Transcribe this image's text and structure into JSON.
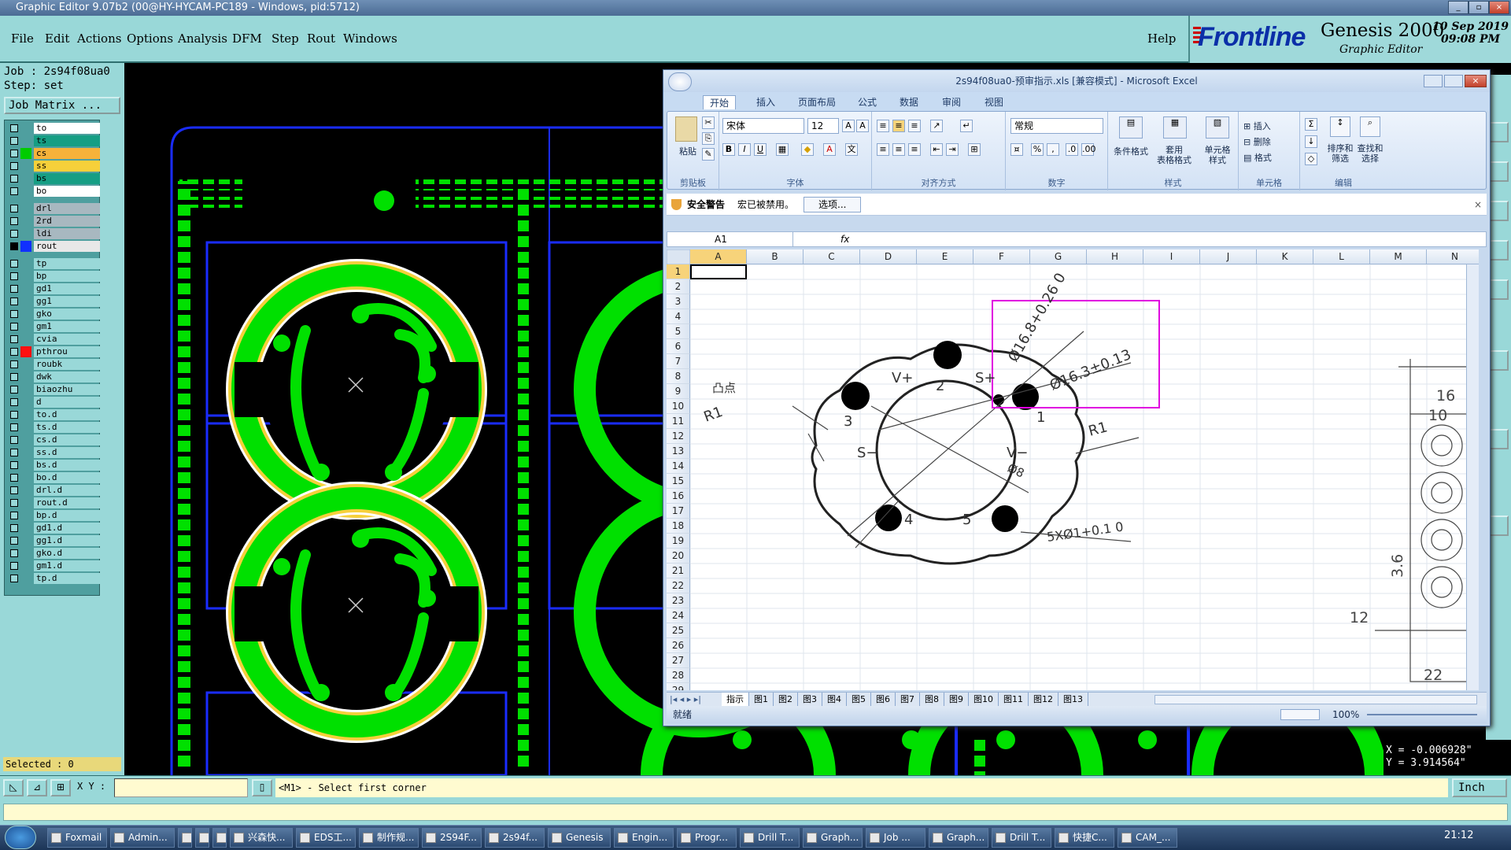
{
  "window": {
    "title": "Graphic Editor 9.07b2 (00@HY-HYCAM-PC189 - Windows, pid:5712)"
  },
  "menu": [
    "File",
    "Edit",
    "Actions",
    "Options",
    "Analysis",
    "DFM",
    "Step",
    "Rout",
    "Windows"
  ],
  "help_label": "Help",
  "branding": {
    "logo": "Frontline",
    "product": "Genesis 2000",
    "subtitle": "Graphic Editor",
    "date": "10 Sep 2019",
    "time": "09:08 PM"
  },
  "job": {
    "job_label": "Job : 2s94f08ua0",
    "step_label": "Step: set",
    "matrix_button": "Job Matrix ..."
  },
  "layers": [
    {
      "name": "to",
      "color": "#ffffff",
      "swatch": "",
      "checked": false
    },
    {
      "name": "ts",
      "color": "#169e84",
      "swatch": "",
      "checked": false
    },
    {
      "name": "cs",
      "color": "#f6b23a",
      "swatch": "#00cc00",
      "checked": false
    },
    {
      "name": "ss",
      "color": "#f6d03a",
      "swatch": "",
      "checked": false
    },
    {
      "name": "bs",
      "color": "#169e84",
      "swatch": "",
      "checked": false
    },
    {
      "name": "bo",
      "color": "#ffffff",
      "swatch": "",
      "checked": false
    },
    {
      "name": "drl",
      "color": "#a8b8c0",
      "swatch": "",
      "checked": false
    },
    {
      "name": "2rd",
      "color": "#a8b8c0",
      "swatch": "",
      "checked": false
    },
    {
      "name": "ldi",
      "color": "#a8b8c0",
      "swatch": "",
      "checked": false
    },
    {
      "name": "rout",
      "color": "#e8e8e8",
      "swatch": "#1030ff",
      "checked": true
    },
    {
      "name": "tp",
      "color": "#99d8d8",
      "swatch": "",
      "checked": false
    },
    {
      "name": "bp",
      "color": "#99d8d8",
      "swatch": "",
      "checked": false
    },
    {
      "name": "gd1",
      "color": "#99d8d8",
      "swatch": "",
      "checked": false
    },
    {
      "name": "gg1",
      "color": "#99d8d8",
      "swatch": "",
      "checked": false
    },
    {
      "name": "gko",
      "color": "#99d8d8",
      "swatch": "",
      "checked": false
    },
    {
      "name": "gm1",
      "color": "#99d8d8",
      "swatch": "",
      "checked": false
    },
    {
      "name": "cvia",
      "color": "#99d8d8",
      "swatch": "",
      "checked": false
    },
    {
      "name": "pthrou",
      "color": "#99d8d8",
      "swatch": "#ff1010",
      "checked": false
    },
    {
      "name": "roubk",
      "color": "#99d8d8",
      "swatch": "",
      "checked": false
    },
    {
      "name": "dwk",
      "color": "#99d8d8",
      "swatch": "",
      "checked": false
    },
    {
      "name": "biaozhu",
      "color": "#99d8d8",
      "swatch": "",
      "checked": false
    },
    {
      "name": "d",
      "color": "#99d8d8",
      "swatch": "",
      "checked": false
    },
    {
      "name": "to.d",
      "color": "#99d8d8",
      "swatch": "",
      "checked": false
    },
    {
      "name": "ts.d",
      "color": "#99d8d8",
      "swatch": "",
      "checked": false
    },
    {
      "name": "cs.d",
      "color": "#99d8d8",
      "swatch": "",
      "checked": false
    },
    {
      "name": "ss.d",
      "color": "#99d8d8",
      "swatch": "",
      "checked": false
    },
    {
      "name": "bs.d",
      "color": "#99d8d8",
      "swatch": "",
      "checked": false
    },
    {
      "name": "bo.d",
      "color": "#99d8d8",
      "swatch": "",
      "checked": false
    },
    {
      "name": "drl.d",
      "color": "#99d8d8",
      "swatch": "",
      "checked": false
    },
    {
      "name": "rout.d",
      "color": "#99d8d8",
      "swatch": "",
      "checked": false
    },
    {
      "name": "bp.d",
      "color": "#99d8d8",
      "swatch": "",
      "checked": false
    },
    {
      "name": "gd1.d",
      "color": "#99d8d8",
      "swatch": "",
      "checked": false
    },
    {
      "name": "gg1.d",
      "color": "#99d8d8",
      "swatch": "",
      "checked": false
    },
    {
      "name": "gko.d",
      "color": "#99d8d8",
      "swatch": "",
      "checked": false
    },
    {
      "name": "gm1.d",
      "color": "#99d8d8",
      "swatch": "",
      "checked": false
    },
    {
      "name": "tp.d",
      "color": "#99d8d8",
      "swatch": "",
      "checked": false
    }
  ],
  "selected_label": "Selected : 0",
  "coords": {
    "x": "X = -0.006928\"",
    "y": "Y = 3.914564\""
  },
  "statusbar": {
    "xy_label": "X Y :",
    "prompt": "<M1> - Select first corner",
    "unit": "Inch"
  },
  "excel": {
    "title": "2s94f08ua0-预审指示.xls  [兼容模式]  -  Microsoft Excel",
    "tabs": [
      "开始",
      "插入",
      "页面布局",
      "公式",
      "数据",
      "审阅",
      "视图"
    ],
    "ribbon": {
      "paste": "粘贴",
      "clipboard": "剪贴板",
      "font_name": "宋体",
      "font_size": "12",
      "font_group": "字体",
      "align_group": "对齐方式",
      "number_format": "常规",
      "number_group": "数字",
      "cond_format": "条件格式",
      "table_format": "套用\n表格格式",
      "cell_style": "单元格\n样式",
      "styles_group": "样式",
      "insert": "插入",
      "delete": "删除",
      "format": "格式",
      "cells_group": "单元格",
      "sort": "排序和\n筛选",
      "find": "查找和\n选择",
      "edit_group": "编辑"
    },
    "security": {
      "label": "安全警告",
      "message": "宏已被禁用。",
      "button": "选项..."
    },
    "name_box": "A1",
    "fx": "fx",
    "columns": [
      "A",
      "B",
      "C",
      "D",
      "E",
      "F",
      "G",
      "H",
      "I",
      "J",
      "K",
      "L",
      "M",
      "N"
    ],
    "rows": [
      "1",
      "2",
      "3",
      "4",
      "5",
      "6",
      "7",
      "8",
      "9",
      "10",
      "11",
      "12",
      "13",
      "14",
      "15",
      "16",
      "17",
      "18",
      "19",
      "20",
      "21",
      "22",
      "23",
      "24",
      "25",
      "26",
      "27",
      "28",
      "29"
    ],
    "sheets": [
      "指示",
      "图1",
      "图2",
      "图3",
      "图4",
      "图5",
      "图6",
      "图7",
      "图8",
      "图9",
      "图10",
      "图11",
      "图12",
      "图13"
    ],
    "status": "就绪",
    "zoom": "100%",
    "drawing": {
      "dims": [
        "Ø16.8+0.26 0",
        "Ø16.3±0.13",
        "R1",
        "R1",
        "Ø8",
        "5XØ1+0.1 0"
      ],
      "labels": [
        "凸点",
        "V+",
        "S+",
        "S−",
        "V−",
        "1",
        "2",
        "3",
        "4",
        "5"
      ],
      "side_dims": [
        "16",
        "10",
        "3.6",
        "12",
        "22"
      ]
    }
  },
  "taskbar": [
    "Foxmail",
    "Admin...",
    "",
    "",
    "",
    "兴森快...",
    "EDS工...",
    "制作规...",
    "2S94F...",
    "2s94f...",
    "Genesis",
    "Engin...",
    "Progr...",
    "Drill T...",
    "Graph...",
    "Job ...",
    "Graph...",
    "Drill T...",
    "快捷C...",
    "CAM_..."
  ],
  "clock": "21:12"
}
